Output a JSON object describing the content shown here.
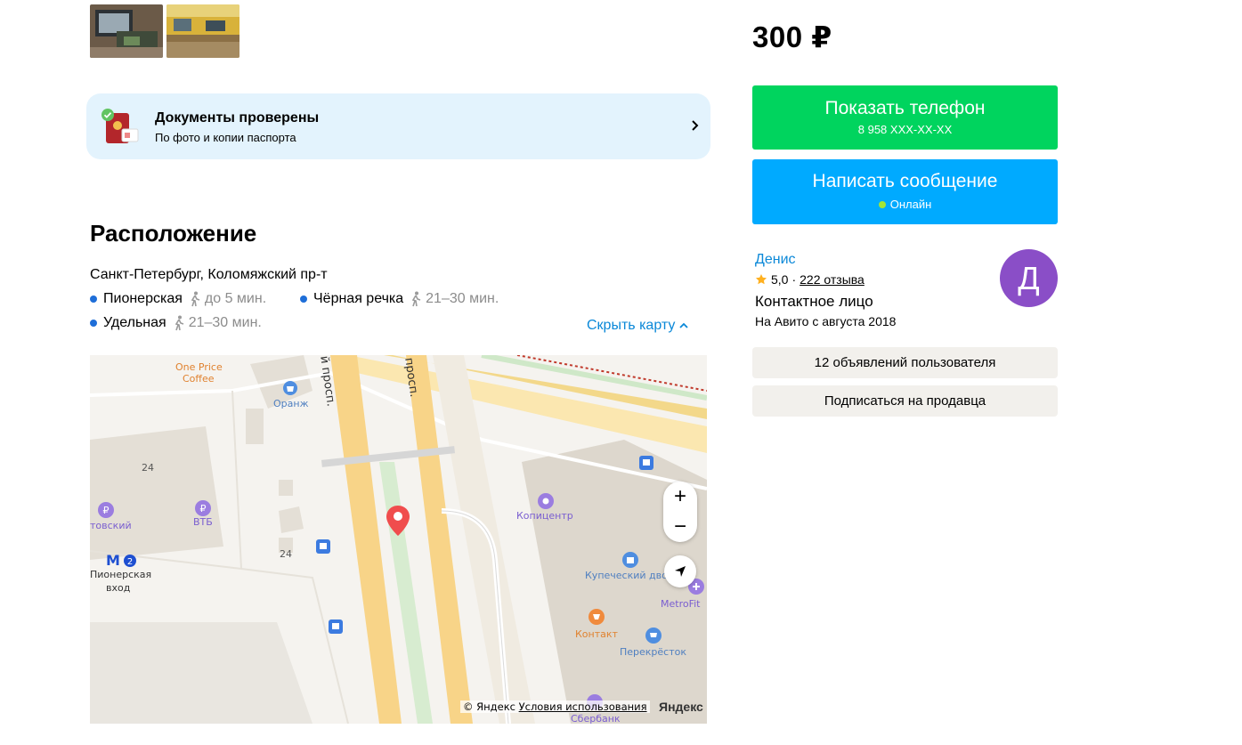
{
  "gallery": {
    "thumbnails": [
      "thumb-laptop-repair",
      "thumb-workshop"
    ]
  },
  "documents": {
    "title": "Документы проверены",
    "subtitle": "По фото и копии паспорта"
  },
  "location": {
    "heading": "Расположение",
    "address": "Санкт-Петербург, Коломяжский пр-т",
    "metro": [
      {
        "station": "Пионерская",
        "time": "до 5 мин."
      },
      {
        "station": "Чёрная речка",
        "time": "21–30 мин."
      },
      {
        "station": "Удельная",
        "time": "21–30 мин."
      }
    ],
    "hide_map": "Скрыть карту"
  },
  "map": {
    "labels": {
      "one_price_1": "One Price",
      "one_price_2": "Coffee",
      "oranzh": "Оранж",
      "street1": "й просп.",
      "street2": "просп.",
      "num24a": "24",
      "num24b": "24",
      "bank_left": "товский",
      "vtb": "ВТБ",
      "pioner_1": "Пионерская",
      "pioner_2": "вход",
      "metro_line": "2",
      "kopicentr": "Копицентр",
      "kupech": "Купеческий дво",
      "metrofit": "MetroFit",
      "kontakt": "Контакт",
      "perekrestok": "Перекрёсток",
      "sberbank": "Сбербанк"
    },
    "copyright": "© Яндекс",
    "terms": "Условия использования",
    "brand": "Яндекс",
    "zoom_in": "+",
    "zoom_out": "−"
  },
  "sidebar": {
    "price": "300 ₽",
    "show_phone": "Показать телефон",
    "phone_masked": "8 958 XXX-XX-XX",
    "write_message": "Написать сообщение",
    "online": "Онлайн",
    "seller_name": "Денис",
    "rating": "5,0",
    "rating_sep": "·",
    "reviews": "222 отзыва",
    "role": "Контактное лицо",
    "since": "На Авито с августа 2018",
    "avatar_letter": "Д",
    "listings_button": "12 объявлений пользователя",
    "subscribe_button": "Подписаться на продавца"
  },
  "colors": {
    "green": "#00d45e",
    "blue": "#00aaff",
    "link": "#0a88d8",
    "avatar": "#8a4ec7",
    "metro_dot": "#1e6ed8",
    "online": "#a3e635"
  }
}
